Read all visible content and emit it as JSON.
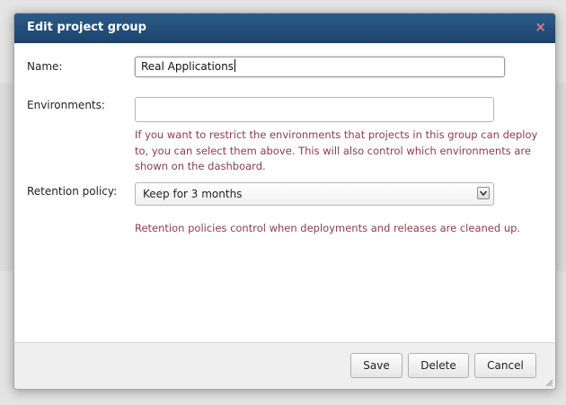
{
  "dialog": {
    "title": "Edit project group",
    "close_label": "×"
  },
  "form": {
    "name_label": "Name:",
    "name_value": "Real Applications",
    "environments_label": "Environments:",
    "environments_value": "",
    "environments_help": [
      "If you want to restrict the environments that projects in this group can deploy",
      "to, you can select them above. This will also control which environments are",
      "shown on the dashboard."
    ],
    "retention_label": "Retention policy:",
    "retention_selected": "Keep for 3 months",
    "retention_help": "Retention policies control when deployments and releases are cleaned up."
  },
  "buttons": {
    "save": "Save",
    "delete": "Delete",
    "cancel": "Cancel"
  },
  "icons": {
    "close": "close-icon",
    "select_arrow": "chevron-down-icon",
    "resize": "resize-grip-icon"
  },
  "colors": {
    "titlebar": "#1f4b76",
    "help_text": "#8a3d4a",
    "close": "#e07a86"
  }
}
